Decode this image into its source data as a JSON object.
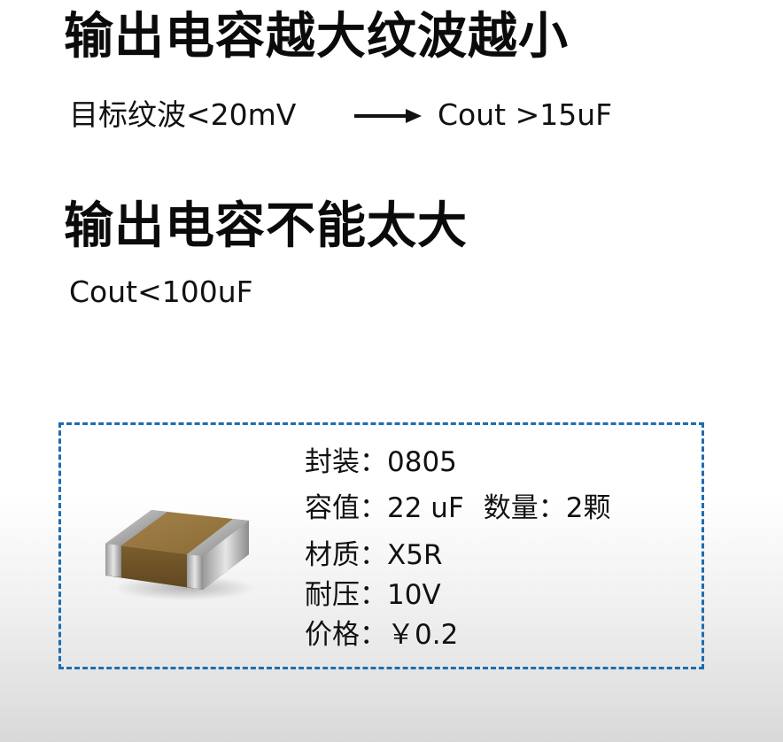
{
  "heading1": "输出电容越大纹波越小",
  "ripple_target": "目标纹波<20mV",
  "cout_min": "Cout >15uF",
  "heading2": "输出电容不能太大",
  "cout_max": "Cout<100uF",
  "specs": {
    "package_label": "封装：",
    "package_value": "0805",
    "capacitance_label": "容值：",
    "capacitance_value": "22 uF",
    "quantity_label": "数量：",
    "quantity_value": "2颗",
    "material_label": "材质：",
    "material_value": "X5R",
    "voltage_label": "耐压：",
    "voltage_value": "10V",
    "price_label": "价格：",
    "price_value": "￥0.2"
  },
  "colors": {
    "box_border": "#1f6bb3",
    "chip_body": "#8a6a35",
    "chip_terminal": "#b5b5b5"
  },
  "icons": {
    "arrow": "right-arrow-icon",
    "component": "ceramic-capacitor-chip"
  }
}
